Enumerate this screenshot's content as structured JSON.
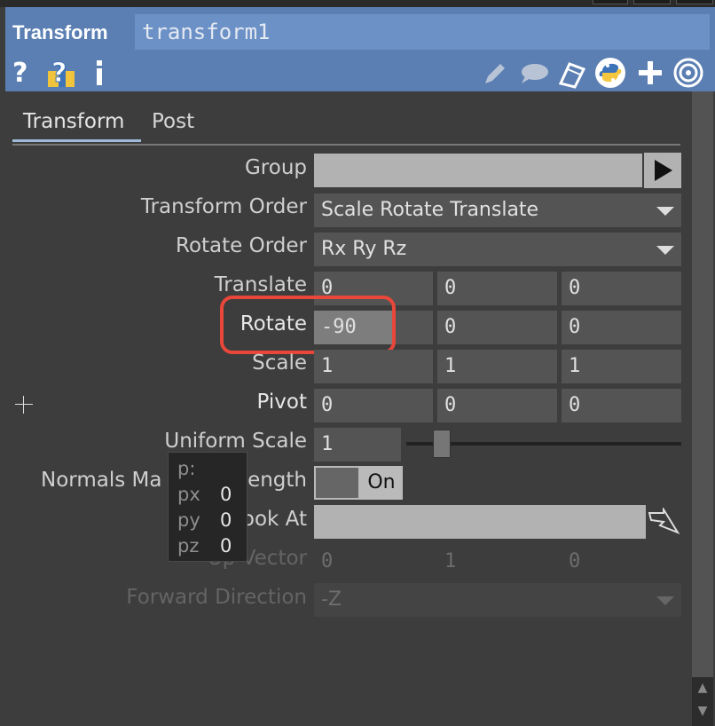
{
  "header": {
    "op_type": "Transform",
    "op_name": "transform1",
    "icons": [
      "help-icon",
      "python-help-icon",
      "info-icon",
      "edit-icon",
      "comment-icon",
      "clipboard-icon",
      "python-icon",
      "add-icon",
      "target-icon"
    ]
  },
  "tabs": [
    {
      "label": "Transform",
      "active": true
    },
    {
      "label": "Post",
      "active": false
    }
  ],
  "params": {
    "group": {
      "label": "Group",
      "value": ""
    },
    "transform_order": {
      "label": "Transform Order",
      "value": "Scale Rotate Translate"
    },
    "rotate_order": {
      "label": "Rotate Order",
      "value": "Rx Ry Rz"
    },
    "translate": {
      "label": "Translate",
      "values": [
        "0",
        "0",
        "0"
      ]
    },
    "rotate": {
      "label": "Rotate",
      "values": [
        "-90",
        "0",
        "0"
      ]
    },
    "scale": {
      "label": "Scale",
      "values": [
        "1",
        "1",
        "1"
      ]
    },
    "pivot": {
      "label": "Pivot",
      "values": [
        "0",
        "0",
        "0"
      ]
    },
    "uniform_scale": {
      "label": "Uniform Scale",
      "value": "1"
    },
    "normals_mag": {
      "label": "Normals Magnitude Strength",
      "label_visible_left": "Normals Ma",
      "label_visible_right": "ength",
      "value": "On"
    },
    "look_at": {
      "label": "Look At",
      "label_visible": "ook At",
      "value": ""
    },
    "up_vector": {
      "label": "Up Vector",
      "label_visible": "Up Vector",
      "values": [
        "0",
        "1",
        "0"
      ]
    },
    "forward_direction": {
      "label": "Forward Direction",
      "value": "-Z"
    }
  },
  "tooltip": {
    "title": "p:",
    "rows": [
      {
        "name": "px",
        "value": "0"
      },
      {
        "name": "py",
        "value": "0"
      },
      {
        "name": "pz",
        "value": "0"
      }
    ]
  },
  "colors": {
    "header_bg": "#5b7fb3",
    "highlight_ring": "#e8473a",
    "python_blue": "#3d73b8",
    "python_yellow": "#f5c640",
    "help_yellow": "#f0c43c"
  }
}
